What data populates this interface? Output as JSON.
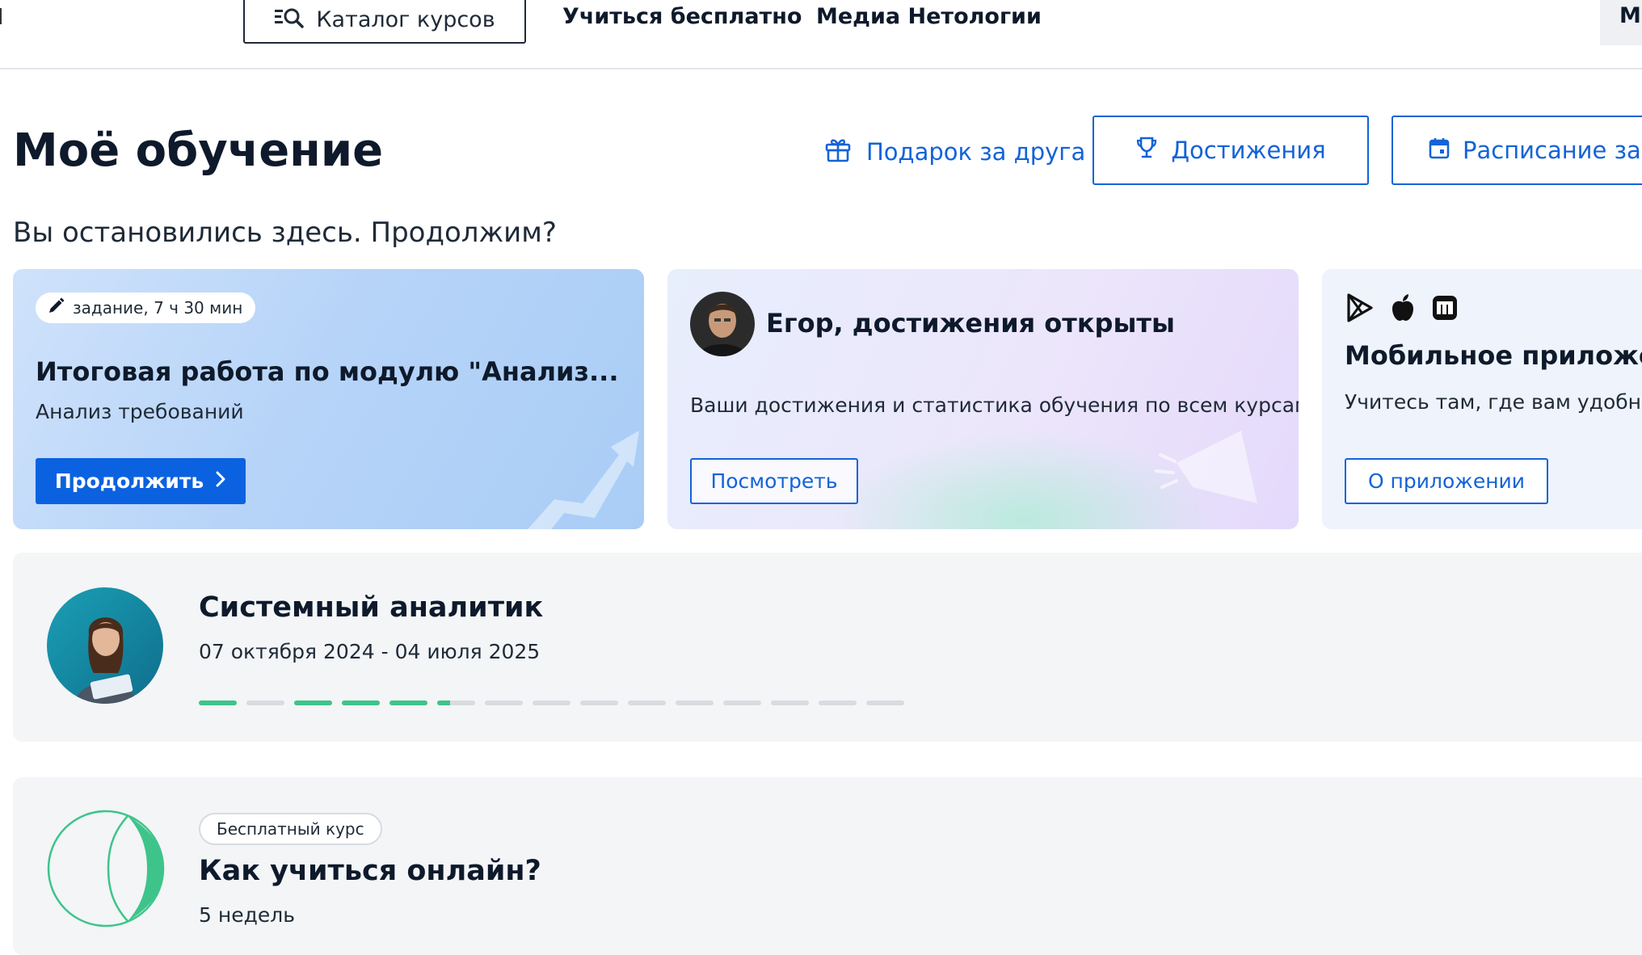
{
  "nav": {
    "catalog_label": "Каталог курсов",
    "link_free": "Учиться бесплатно",
    "link_media": "Медиа Нетологии",
    "right_fragment": "Мо"
  },
  "header": {
    "title": "Моё обучение",
    "gift_label": "Подарок за друга",
    "achievements_label": "Достижения",
    "schedule_label": "Расписание занятий"
  },
  "continue_prompt": "Вы остановились здесь. Продолжим?",
  "cards": {
    "task": {
      "pill": "задание, 7 ч 30 мин",
      "title": "Итоговая работа по модулю \"Анализ...",
      "subtitle": "Анализ требований",
      "button": "Продолжить"
    },
    "achievements": {
      "title": "Егор, достижения открыты",
      "description": "Ваши достижения и статистика обучения по всем курсам",
      "button": "Посмотреть"
    },
    "app": {
      "icons": [
        "google-play-icon",
        "apple-icon",
        "rustore-icon"
      ],
      "title": "Мобильное приложение",
      "description": "Учитесь там, где вам удобно",
      "button": "О приложении"
    }
  },
  "courses": [
    {
      "title": "Системный аналитик",
      "dates": "07 октября 2024 - 04 июля 2025",
      "progress": [
        1,
        0,
        1,
        1,
        1,
        0.35,
        0,
        0,
        0,
        0,
        0,
        0,
        0,
        0,
        0
      ]
    },
    {
      "badge": "Бесплатный курс",
      "title": "Как учиться онлайн?",
      "duration": "5 недель"
    }
  ],
  "colors": {
    "accent": "#1363d7",
    "primary_button": "#0b62e0",
    "progress_fill": "#3ec48a",
    "progress_empty": "#d8dce1",
    "course_bg": "#f3f5f7"
  }
}
